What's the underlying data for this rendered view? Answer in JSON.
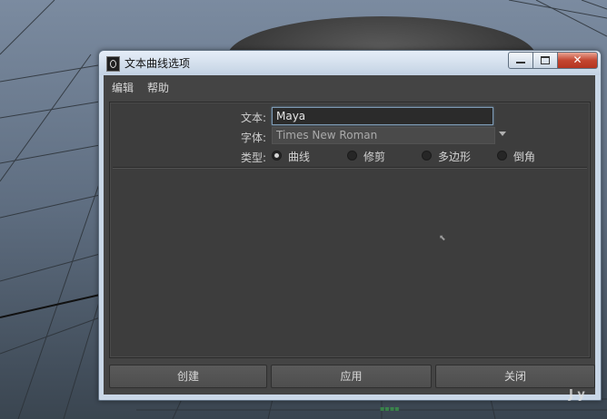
{
  "window": {
    "title": "文本曲线选项",
    "controls": {
      "minimize_icon": "minimize-icon",
      "maximize_icon": "maximize-icon",
      "close_icon": "close-icon",
      "close_glyph": "✕"
    }
  },
  "menubar": {
    "items": [
      {
        "label": "编辑"
      },
      {
        "label": "帮助"
      }
    ]
  },
  "form": {
    "text_label": "文本:",
    "text_value": "Maya",
    "font_label": "字体:",
    "font_value": "Times New Roman",
    "type_label": "类型:",
    "type_options": [
      {
        "label": "曲线",
        "selected": true
      },
      {
        "label": "修剪",
        "selected": false
      },
      {
        "label": "多边形",
        "selected": false
      },
      {
        "label": "倒角",
        "selected": false
      }
    ]
  },
  "buttons": {
    "create": "创建",
    "apply": "应用",
    "close": "关闭"
  },
  "watermark": {
    "corner": "J  y"
  },
  "colors": {
    "accent_border": "#7d9ab4",
    "close_button": "#c44631",
    "panel_bg": "#444444"
  }
}
